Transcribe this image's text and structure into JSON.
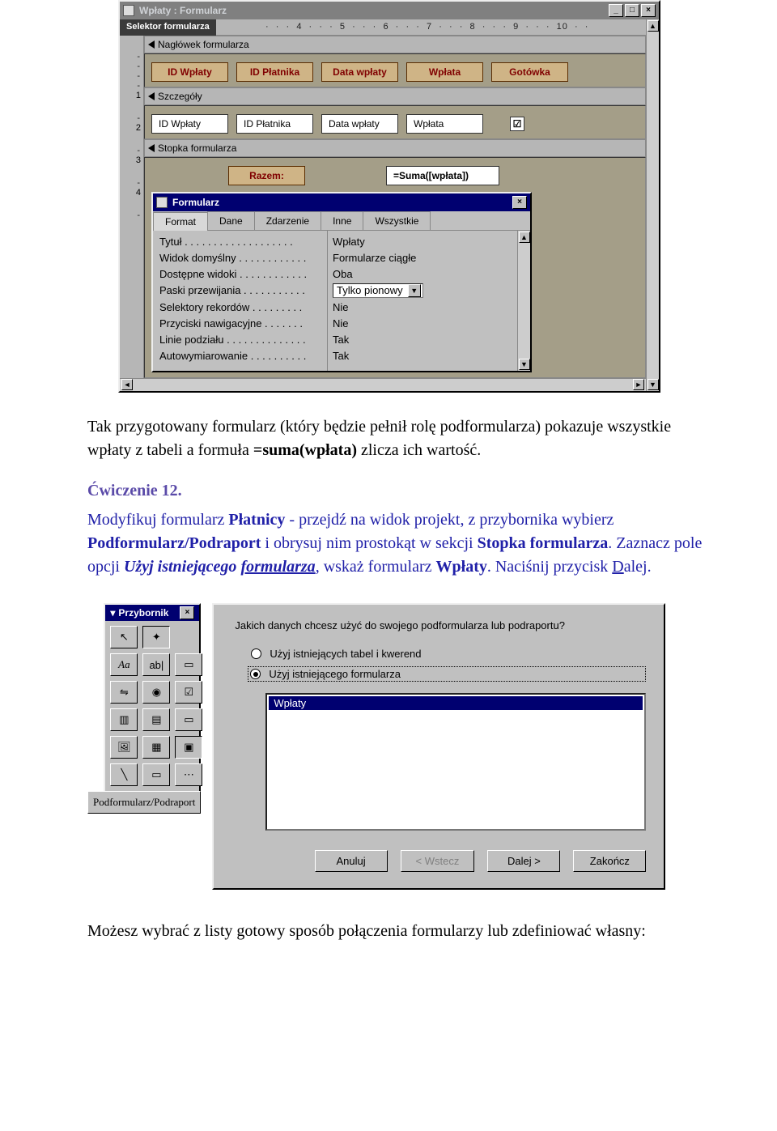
{
  "window": {
    "title": "Wpłaty : Formularz",
    "selector_label": "Selektor formularza",
    "ruler_h": "·  ·  ·  4  ·  ·  ·  5  ·  ·  ·  6  ·  ·  ·  7  ·  ·  ·  8  ·  ·  ·  9  ·  ·  ·  10  ·  ·",
    "sections": {
      "header": "Nagłówek formularza",
      "detail": "Szczegóły",
      "footer": "Stopka formularza"
    },
    "header_labels": [
      "ID Wpłaty",
      "ID Płatnika",
      "Data wpłaty",
      "Wpłata",
      "Gotówka"
    ],
    "detail_fields": [
      "ID Wpłaty",
      "ID Płatnika",
      "Data wpłaty",
      "Wpłata"
    ],
    "checkbox": "☑",
    "footer_label": "Razem:",
    "footer_formula": "=Suma([wpłata])"
  },
  "propsheet": {
    "title": "Formularz",
    "tabs": [
      "Format",
      "Dane",
      "Zdarzenie",
      "Inne",
      "Wszystkie"
    ],
    "rows": [
      {
        "label": "Tytuł . . . . . . . . . . . . . . . . . . .",
        "value": "Wpłaty"
      },
      {
        "label": "Widok domyślny . . . . . . . . . . . .",
        "value": "Formularze ciągłe"
      },
      {
        "label": "Dostępne widoki . . . . . . . . . . . .",
        "value": "Oba"
      },
      {
        "label": "Paski przewijania . . . . . . . . . . .",
        "value": "Tylko pionowy",
        "combo": true
      },
      {
        "label": "Selektory rekordów . . . . . . . . .",
        "value": "Nie"
      },
      {
        "label": "Przyciski nawigacyjne . . . . . . .",
        "value": "Nie"
      },
      {
        "label": "Linie podziału . . . . . . . . . . . . . .",
        "value": "Tak"
      },
      {
        "label": "Autowymiarowanie . . . . . . . . . .",
        "value": "Tak"
      }
    ]
  },
  "para1": {
    "a": "Tak przygotowany formularz (który będzie pełnił rolę podformularza) pokazuje wszystkie wpłaty z tabeli a formuła ",
    "b": "=suma(wpłata)",
    "c": " zlicza ich wartość."
  },
  "exercise_label": "Ćwiczenie 12.",
  "para2": {
    "a": "Modyfikuj formularz ",
    "b": "Płatnicy",
    "c": " - przejdź na widok projekt, z przybornika wybierz ",
    "d": "Podformularz/Podraport",
    "e": " i obrysuj nim prostokąt w sekcji ",
    "f": "Stopka formularza",
    "g": ". Zaznacz pole opcji ",
    "h": "Użyj istniejącego ",
    "i": "formularza",
    "j": ", wskaż formularz ",
    "k": "Wpłaty",
    "l": ". Naciśnij przycisk ",
    "m": "D",
    "n": "alej."
  },
  "toolbox": {
    "title": "Przybornik",
    "subform_label": "Podformularz/Podraport"
  },
  "wizard": {
    "question": "Jakich danych chcesz użyć do swojego podformularza lub podraportu?",
    "opt1": "Użyj istniejących tabel i kwerend",
    "opt2": "Użyj istniejącego formularza",
    "list_item": "Wpłaty",
    "btn_cancel": "Anuluj",
    "btn_back": "< Wstecz",
    "btn_next": "Dalej >",
    "btn_finish": "Zakończ"
  },
  "final_para": "Możesz wybrać z listy gotowy sposób połączenia formularzy lub zdefiniować własny:"
}
